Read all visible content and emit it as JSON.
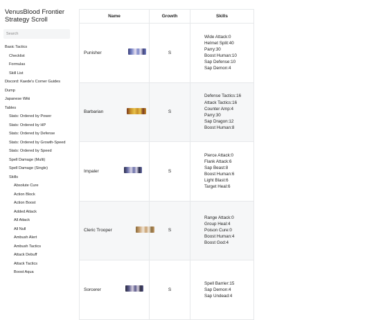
{
  "sidebar": {
    "title": "VenusBlood Frontier Strategy Scroll",
    "search_placeholder": "Search",
    "items": [
      {
        "label": "Basic Tactics",
        "level": 0
      },
      {
        "label": "Checklist",
        "level": 1
      },
      {
        "label": "Formulas",
        "level": 1
      },
      {
        "label": "Skill List",
        "level": 1
      },
      {
        "label": "Discord: Kaede's Corner Guides",
        "level": 0
      },
      {
        "label": "Dump",
        "level": 0
      },
      {
        "label": "Japanese Wiki",
        "level": 0
      },
      {
        "label": "Tables",
        "level": 0
      },
      {
        "label": "Stats: Ordered by Power",
        "level": 1
      },
      {
        "label": "Stats: Ordered by HP",
        "level": 1
      },
      {
        "label": "Stats: Ordered by Defense",
        "level": 1
      },
      {
        "label": "Stats: Ordered by Growth-Speed",
        "level": 1
      },
      {
        "label": "Stats: Ordered by Speed",
        "level": 1
      },
      {
        "label": "Spell Damage (Multi)",
        "level": 1
      },
      {
        "label": "Spell Damage (Single)",
        "level": 1
      },
      {
        "label": "Skills",
        "level": 1
      },
      {
        "label": "Absolute Cure",
        "level": 2
      },
      {
        "label": "Action Block",
        "level": 2
      },
      {
        "label": "Action Boost",
        "level": 2
      },
      {
        "label": "Added Attack",
        "level": 2
      },
      {
        "label": "All Attack",
        "level": 2
      },
      {
        "label": "All Null",
        "level": 2
      },
      {
        "label": "Ambush Alert",
        "level": 2
      },
      {
        "label": "Ambush Tactics",
        "level": 2
      },
      {
        "label": "Attack Debuff",
        "level": 2
      },
      {
        "label": "Attack Tactics",
        "level": 2
      },
      {
        "label": "Boost Aqua",
        "level": 2
      }
    ]
  },
  "table": {
    "headers": {
      "name": "Name",
      "growth": "Growth",
      "skills": "Skills"
    },
    "rows": [
      {
        "name": "Punisher",
        "growth": "S",
        "sprite_colors": [
          "#7a86c8",
          "#e8e2f0",
          "#3b3f7a"
        ],
        "skills": [
          "Wide Attack:0",
          "Helmet Split:40",
          "Parry:30",
          "Boost Human:10",
          "Sap Defense:10",
          "Sap Demon:4"
        ]
      },
      {
        "name": "Barbarian",
        "growth": "S",
        "sprite_colors": [
          "#c8902a",
          "#e8c24a",
          "#7a3b20"
        ],
        "skills": [
          "Defense Tactics:16",
          "Attack Tactics:16",
          "Counter Amp:4",
          "Parry:30",
          "Sap Dragon:12",
          "Boost Human:8"
        ]
      },
      {
        "name": "Impaler",
        "growth": "S",
        "sprite_colors": [
          "#6a6fa8",
          "#d8d4e6",
          "#2a2c4a"
        ],
        "skills": [
          "Pierce Attack:0",
          "Flank Attack:6",
          "Sap Beast:8",
          "Boost Human:6",
          "Light Blast:6",
          "Target Heal:6"
        ]
      },
      {
        "name": "Cleric Trooper",
        "growth": "S",
        "sprite_colors": [
          "#c8a070",
          "#f0e6d8",
          "#8a6a3a"
        ],
        "skills": [
          "Range Attack:0",
          "Group Heal:4",
          "Poison Cure:0",
          "Boost Human:4",
          "Boost God:4"
        ]
      },
      {
        "name": "Sorcerer",
        "growth": "S",
        "sprite_colors": [
          "#5a5a8a",
          "#d8d0e0",
          "#2a2a40"
        ],
        "skills": [
          "Spell Barrier:15",
          "Sap Demon:4",
          "Sap Undead:4"
        ]
      }
    ]
  }
}
